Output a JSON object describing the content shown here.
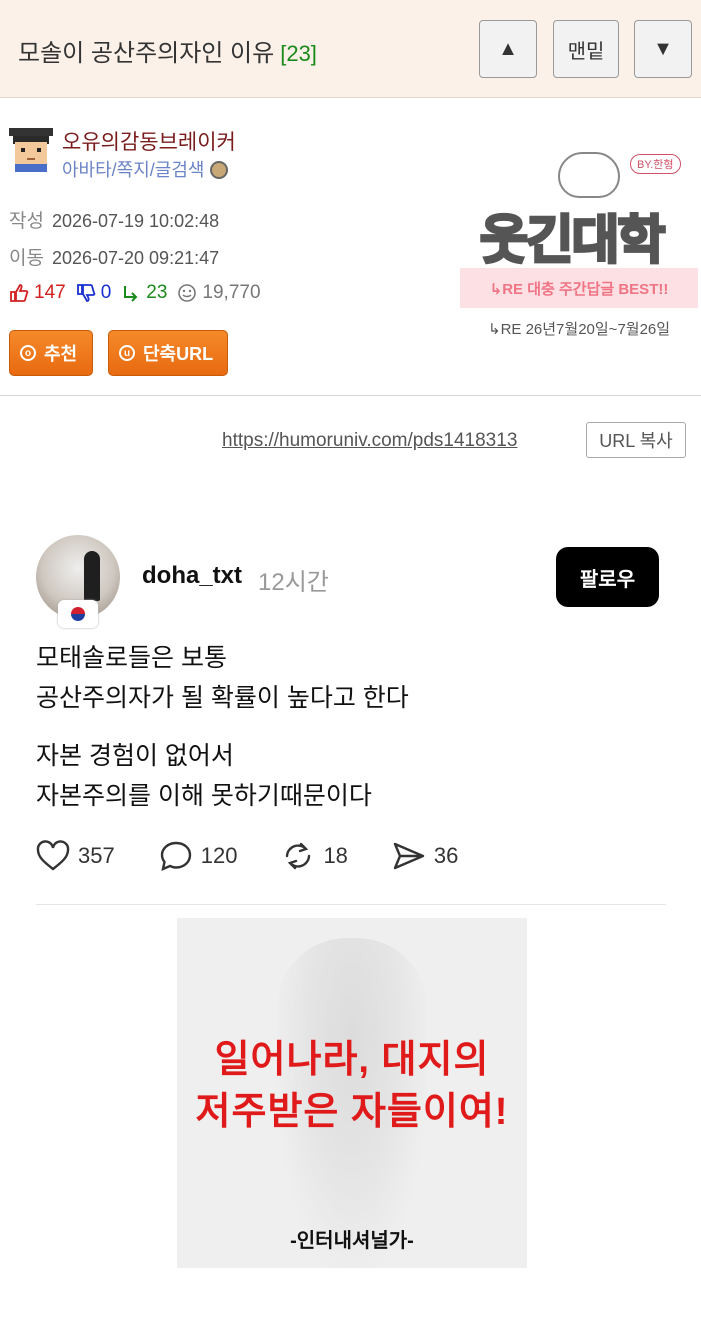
{
  "header": {
    "title": "모솔이 공산주의자인 이유",
    "comment_count": "[23]",
    "btn_up": "▲",
    "btn_bottom": "맨밑",
    "btn_down": "▼"
  },
  "author": {
    "nickname": "오유의감동브레이커",
    "links": "아바타/쪽지/글검색",
    "created_label": "작성",
    "created_value": "2026-07-19 10:02:48",
    "moved_label": "이동",
    "moved_value": "2026-07-20 09:21:47"
  },
  "stats": {
    "likes": "147",
    "dislikes": "0",
    "replies": "23",
    "views": "19,770"
  },
  "buttons": {
    "recommend": "추천",
    "short_url": "단축URL",
    "copy_url": "URL 복사"
  },
  "logo": {
    "text": "웃긴대학",
    "by": "BY.한형",
    "sub": "↳RE  대충 주간답글 BEST!!",
    "date": "↳RE 26년7월20일~7월26일"
  },
  "permalink": "https://humoruniv.com/pds1418313",
  "post": {
    "username": "doha_txt",
    "ago": "12시간",
    "follow": "팔로우",
    "para1": "모태솔로들은 보통\n공산주의자가 될 확률이 높다고 한다",
    "para2": "자본 경험이 없어서\n자본주의를 이해 못하기때문이다",
    "likes": "357",
    "comments": "120",
    "reposts": "18",
    "shares": "36"
  },
  "meme": {
    "line1": "일어나라, 대지의",
    "line2": "저주받은 자들이여!",
    "caption": "-인터내셔널가-"
  },
  "colors": {
    "header_bg": "#fcf1e8",
    "accent_orange": "#ee7a1c",
    "like_red": "#d32020",
    "dislike_blue": "#1a2fd0",
    "reply_green": "#1a8a1a",
    "meme_red": "#e01a1a"
  }
}
